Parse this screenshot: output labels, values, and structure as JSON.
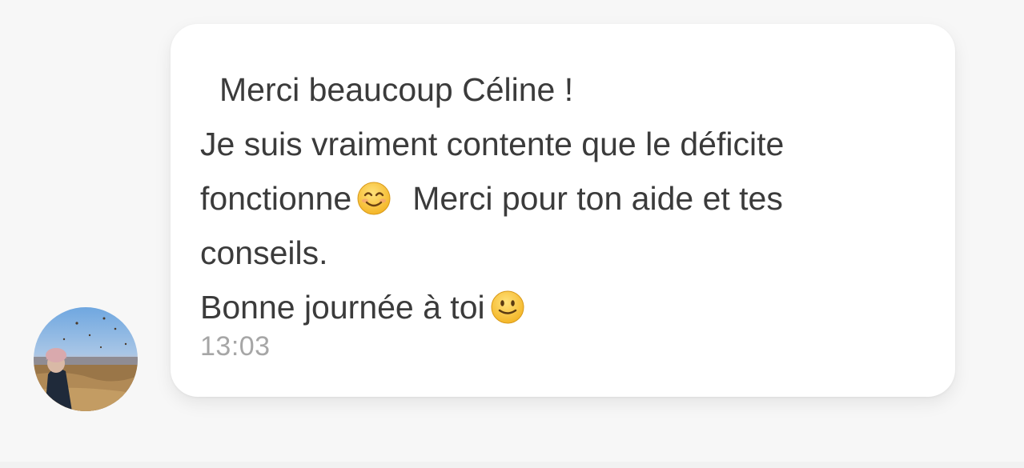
{
  "message": {
    "line1": "Merci beaucoup Céline !",
    "line2": "Je suis vraiment contente que le déficite",
    "line3a": "fonctionne",
    "line3b": "Merci pour ton aide et tes",
    "line4": "conseils.",
    "line5": "Bonne journée à toi",
    "timestamp": "13:03"
  },
  "icons": {
    "emoji_1": "smiling-face-with-smiling-eyes-icon",
    "emoji_2": "slightly-smiling-face-icon"
  },
  "colors": {
    "text": "#3b3b3b",
    "timestamp": "#a6a6a6",
    "bubble": "#ffffff",
    "background": "#f7f7f7"
  }
}
